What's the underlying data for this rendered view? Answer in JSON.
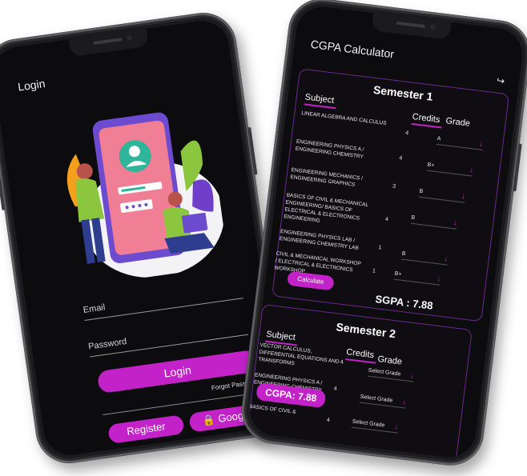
{
  "login": {
    "title": "Login",
    "email_label": "Email",
    "password_label": "Password",
    "login_button": "Login",
    "forgot_password": "Forgot Password?",
    "register_button": "Register",
    "google_button": "Google"
  },
  "cgpa": {
    "title": "CGPA Calculator",
    "semester1": {
      "title": "Semester 1",
      "subject_header": "Subject",
      "credits_header": "Credits",
      "grade_header": "Grade",
      "rows": [
        {
          "subject": "LINEAR ALGEBRA AND CALCULUS",
          "credits": "4",
          "grade": "A"
        },
        {
          "subject": "ENGINEERING PHYSICS A / ENGINEERING CHEMISTRY",
          "credits": "4",
          "grade": "B+"
        },
        {
          "subject": "ENGINEERING MECHANICS / ENGINEERING GRAPHICS",
          "credits": "3",
          "grade": "B"
        },
        {
          "subject": "BASICS OF CIVIL & MECHANICAL ENGINEERING/ BASICS OF ELECTRICAL & ELECTRONICS ENGINEERING",
          "credits": "4",
          "grade": "B"
        },
        {
          "subject": "ENGINEERING PHYSICS LAB / ENGINEERING CHEMISTRY LAB",
          "credits": "1",
          "grade": "B"
        },
        {
          "subject": "CIVIL & MECHANICAL WORKSHOP / ELECTRICAL & ELECTRONICS WORKSHOP",
          "credits": "1",
          "grade": "B+"
        }
      ],
      "calculate_button": "Calculate",
      "sgpa": "SGPA : 7.88"
    },
    "semester2": {
      "title": "Semester 2",
      "subject_header": "Subject",
      "credits_header": "Credits",
      "grade_header": "Grade",
      "rows": [
        {
          "subject": "VECTOR CALCULUS, DIFFERENTIAL EQUATIONS AND TRANSFORMS",
          "credits": "4",
          "grade": "Select Grade"
        },
        {
          "subject": "ENGINEERING PHYSICS A / ENGINEERING CHEMISTRY",
          "credits": "4",
          "grade": "Select Grade"
        },
        {
          "subject": "BASICS OF CIVIL &",
          "credits": "4",
          "grade": "Select Grade"
        }
      ]
    },
    "cgpa_badge": "CGPA: 7.88"
  },
  "colors": {
    "accent": "#c322c8",
    "screen": "#0c0b0d"
  },
  "icons": [
    "logout-icon",
    "lock-icon",
    "chevron-down-icon"
  ]
}
